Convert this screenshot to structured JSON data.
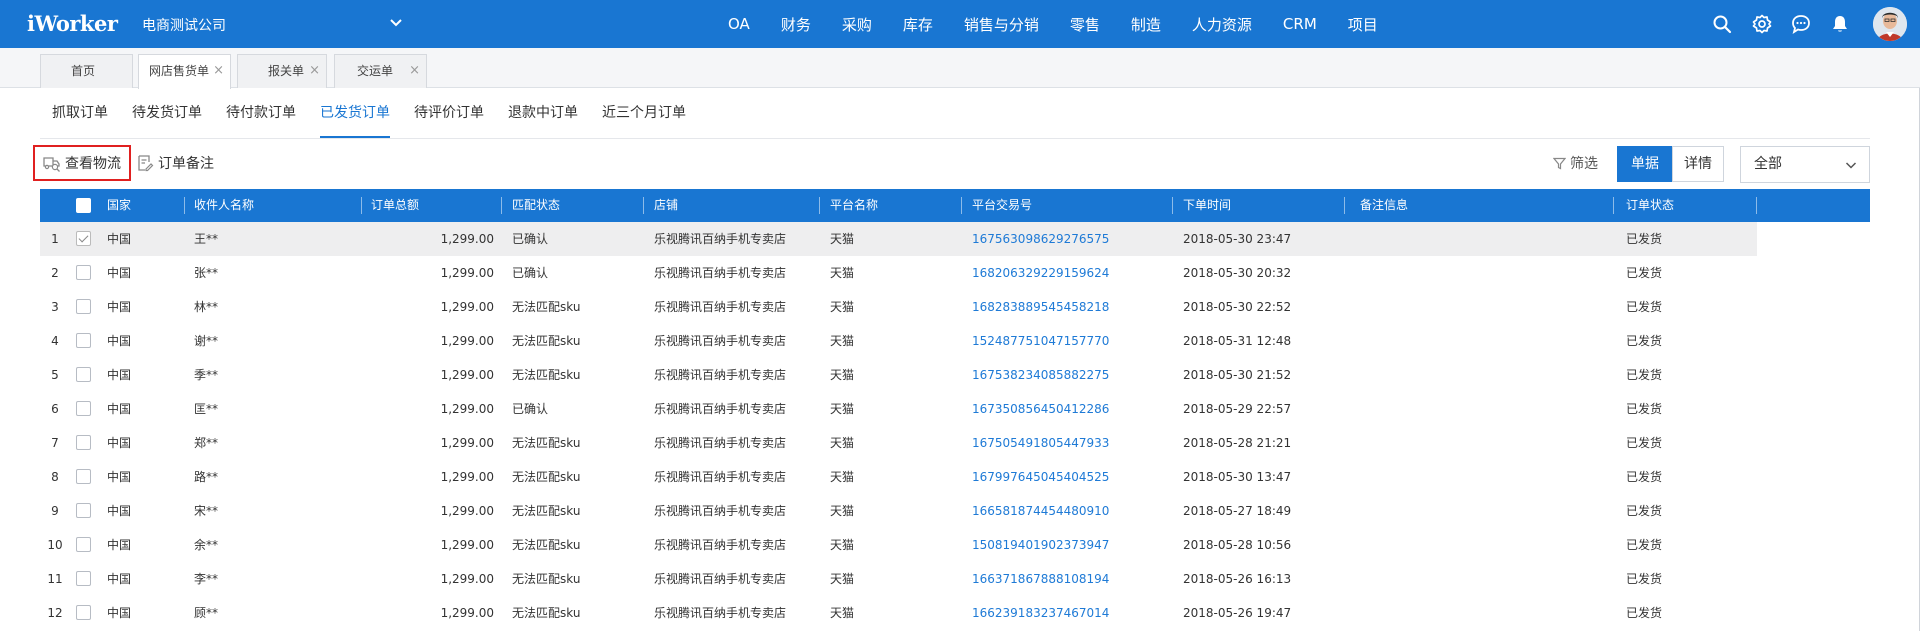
{
  "app": {
    "logo": "iWorker",
    "company": "电商测试公司",
    "nav": [
      "OA",
      "财务",
      "采购",
      "库存",
      "销售与分销",
      "零售",
      "制造",
      "人力资源",
      "CRM",
      "项目"
    ]
  },
  "page_tabs": [
    {
      "label": "首页",
      "closable": false
    },
    {
      "label": "网店售货单",
      "closable": true,
      "active": true
    },
    {
      "label": "报关单",
      "closable": true
    },
    {
      "label": "交运单",
      "closable": true
    }
  ],
  "status_tabs": [
    "抓取订单",
    "待发货订单",
    "待付款订单",
    "已发货订单",
    "待评价订单",
    "退款中订单",
    "近三个月订单"
  ],
  "active_status_tab": "已发货订单",
  "toolbar": {
    "view_logistics": "查看物流",
    "order_note": "订单备注",
    "filter": "筛选",
    "view_list": "单据",
    "view_detail": "详情",
    "select_value": "全部"
  },
  "table": {
    "columns": [
      "国家",
      "收件人名称",
      "订单总额",
      "匹配状态",
      "店铺",
      "平台名称",
      "平台交易号",
      "下单时间",
      "备注信息",
      "订单状态"
    ],
    "rows": [
      {
        "no": "1",
        "country": "中国",
        "recipient": "王**",
        "total": "1,299.00",
        "match": "已确认",
        "shop": "乐视腾讯百纳手机专卖店",
        "platform": "天猫",
        "trade_no": "167563098629276575",
        "time": "2018-05-30 23:47",
        "note": "",
        "status": "已发货",
        "checked": true
      },
      {
        "no": "2",
        "country": "中国",
        "recipient": "张**",
        "total": "1,299.00",
        "match": "已确认",
        "shop": "乐视腾讯百纳手机专卖店",
        "platform": "天猫",
        "trade_no": "168206329229159624",
        "time": "2018-05-30 20:32",
        "note": "",
        "status": "已发货",
        "checked": false
      },
      {
        "no": "3",
        "country": "中国",
        "recipient": "林**",
        "total": "1,299.00",
        "match": "无法匹配sku",
        "shop": "乐视腾讯百纳手机专卖店",
        "platform": "天猫",
        "trade_no": "168283889545458218",
        "time": "2018-05-30 22:52",
        "note": "",
        "status": "已发货",
        "checked": false
      },
      {
        "no": "4",
        "country": "中国",
        "recipient": "谢**",
        "total": "1,299.00",
        "match": "无法匹配sku",
        "shop": "乐视腾讯百纳手机专卖店",
        "platform": "天猫",
        "trade_no": "152487751047157770",
        "time": "2018-05-31 12:48",
        "note": "",
        "status": "已发货",
        "checked": false
      },
      {
        "no": "5",
        "country": "中国",
        "recipient": "季**",
        "total": "1,299.00",
        "match": "无法匹配sku",
        "shop": "乐视腾讯百纳手机专卖店",
        "platform": "天猫",
        "trade_no": "167538234085882275",
        "time": "2018-05-30 21:52",
        "note": "",
        "status": "已发货",
        "checked": false
      },
      {
        "no": "6",
        "country": "中国",
        "recipient": "匡**",
        "total": "1,299.00",
        "match": "已确认",
        "shop": "乐视腾讯百纳手机专卖店",
        "platform": "天猫",
        "trade_no": "167350856450412286",
        "time": "2018-05-29 22:57",
        "note": "",
        "status": "已发货",
        "checked": false
      },
      {
        "no": "7",
        "country": "中国",
        "recipient": "郑**",
        "total": "1,299.00",
        "match": "无法匹配sku",
        "shop": "乐视腾讯百纳手机专卖店",
        "platform": "天猫",
        "trade_no": "167505491805447933",
        "time": "2018-05-28 21:21",
        "note": "",
        "status": "已发货",
        "checked": false
      },
      {
        "no": "8",
        "country": "中国",
        "recipient": "路**",
        "total": "1,299.00",
        "match": "无法匹配sku",
        "shop": "乐视腾讯百纳手机专卖店",
        "platform": "天猫",
        "trade_no": "167997645045404525",
        "time": "2018-05-30 13:47",
        "note": "",
        "status": "已发货",
        "checked": false
      },
      {
        "no": "9",
        "country": "中国",
        "recipient": "宋**",
        "total": "1,299.00",
        "match": "无法匹配sku",
        "shop": "乐视腾讯百纳手机专卖店",
        "platform": "天猫",
        "trade_no": "166581874454480910",
        "time": "2018-05-27 18:49",
        "note": "",
        "status": "已发货",
        "checked": false
      },
      {
        "no": "10",
        "country": "中国",
        "recipient": "余**",
        "total": "1,299.00",
        "match": "无法匹配sku",
        "shop": "乐视腾讯百纳手机专卖店",
        "platform": "天猫",
        "trade_no": "150819401902373947",
        "time": "2018-05-28 10:56",
        "note": "",
        "status": "已发货",
        "checked": false
      },
      {
        "no": "11",
        "country": "中国",
        "recipient": "李**",
        "total": "1,299.00",
        "match": "无法匹配sku",
        "shop": "乐视腾讯百纳手机专卖店",
        "platform": "天猫",
        "trade_no": "166371867888108194",
        "time": "2018-05-26 16:13",
        "note": "",
        "status": "已发货",
        "checked": false
      },
      {
        "no": "12",
        "country": "中国",
        "recipient": "顾**",
        "total": "1,299.00",
        "match": "无法匹配sku",
        "shop": "乐视腾讯百纳手机专卖店",
        "platform": "天猫",
        "trade_no": "166239183237467014",
        "time": "2018-05-26 19:47",
        "note": "",
        "status": "已发货",
        "checked": false
      }
    ]
  },
  "icons": [
    "search-icon",
    "gear-icon",
    "chat-icon",
    "bell-icon",
    "chevron-down-icon",
    "truck-search-icon",
    "note-edit-icon",
    "filter-icon"
  ],
  "colors": {
    "primary": "#1976d2",
    "link": "#1e7ad6",
    "highlight": "#e02020"
  }
}
